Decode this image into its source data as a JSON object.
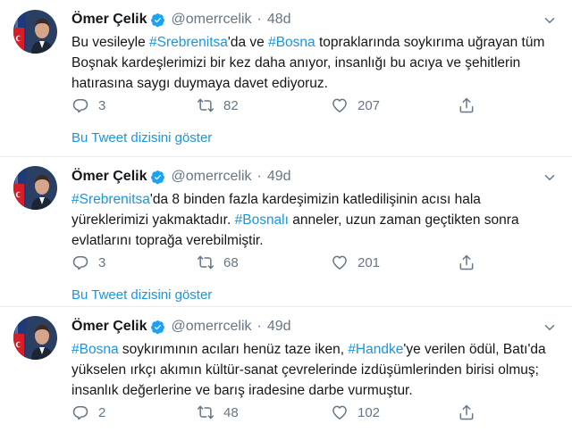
{
  "colors": {
    "link": "#1b95e0",
    "secondary_text": "#657786",
    "primary_text": "#14171a",
    "divider": "#e6ecf0",
    "verified_badge": "#1da1f2"
  },
  "icons": {
    "reply": "reply-icon",
    "retweet": "retweet-icon",
    "like": "heart-icon",
    "share": "share-icon",
    "verified": "verified-badge-icon",
    "menu": "chevron-down-icon"
  },
  "tweets": [
    {
      "author_name": "Ömer Çelik",
      "handle": "@omerrcelik",
      "separator": "·",
      "time": "48d",
      "text_segments": [
        {
          "text": "Bu vesileyle ",
          "type": "text"
        },
        {
          "text": "#Srebrenitsa",
          "type": "hashtag"
        },
        {
          "text": "'da ve ",
          "type": "text"
        },
        {
          "text": "#Bosna",
          "type": "hashtag"
        },
        {
          "text": " topraklarında soykırıma uğrayan tüm Boşnak kardeşlerimizi bir kez daha anıyor, insanlığı bu acıya ve şehitlerin hatırasına saygı duymaya davet ediyoruz.",
          "type": "text"
        }
      ],
      "replies": "3",
      "retweets": "82",
      "likes": "207",
      "thread_link": "Bu Tweet dizisini göster"
    },
    {
      "author_name": "Ömer Çelik",
      "handle": "@omerrcelik",
      "separator": "·",
      "time": "49d",
      "text_segments": [
        {
          "text": "#Srebrenitsa",
          "type": "hashtag"
        },
        {
          "text": "'da 8 binden fazla kardeşimizin katledilişinin acısı hala yüreklerimizi yakmaktadır. ",
          "type": "text"
        },
        {
          "text": "#Bosnalı",
          "type": "hashtag"
        },
        {
          "text": " anneler, uzun zaman geçtikten sonra evlatlarını toprağa verebilmiştir.",
          "type": "text"
        }
      ],
      "replies": "3",
      "retweets": "68",
      "likes": "201",
      "thread_link": "Bu Tweet dizisini göster"
    },
    {
      "author_name": "Ömer Çelik",
      "handle": "@omerrcelik",
      "separator": "·",
      "time": "49d",
      "text_segments": [
        {
          "text": "#Bosna",
          "type": "hashtag"
        },
        {
          "text": " soykırımının acıları henüz taze iken, ",
          "type": "text"
        },
        {
          "text": "#Handke",
          "type": "hashtag"
        },
        {
          "text": "'ye verilen ödül, Batı'da yükselen ırkçı akımın kültür-sanat çevrelerinde izdüşümlerinden birisi olmuş; insanlık değerlerine ve barış iradesine darbe vurmuştur.",
          "type": "text"
        }
      ],
      "replies": "2",
      "retweets": "48",
      "likes": "102"
    }
  ]
}
